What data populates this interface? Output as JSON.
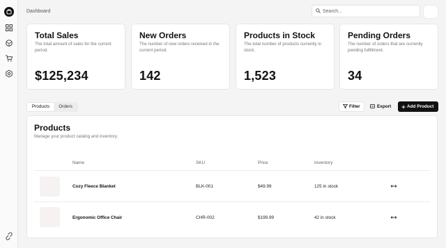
{
  "header": {
    "breadcrumb": "Dashboard",
    "search_placeholder": "Search..."
  },
  "sidebar": {
    "items": [
      {
        "icon": "grid-icon"
      },
      {
        "icon": "package-icon"
      },
      {
        "icon": "cart-icon"
      },
      {
        "icon": "settings-icon"
      }
    ],
    "bottom_icon": "link-icon"
  },
  "stats": [
    {
      "title": "Total Sales",
      "description": "The total amount of sales for the current period.",
      "value": "$125,234"
    },
    {
      "title": "New Orders",
      "description": "The number of new orders received in the current period.",
      "value": "142"
    },
    {
      "title": "Products in Stock",
      "description": "The total number of products currently in stock.",
      "value": "1,523"
    },
    {
      "title": "Pending Orders",
      "description": "The number of orders that are currently pending fulfillment.",
      "value": "34"
    }
  ],
  "tabs": [
    {
      "label": "Products",
      "active": true
    },
    {
      "label": "Orders",
      "active": false
    }
  ],
  "toolbar": {
    "filter_label": "Filter",
    "export_label": "Export",
    "add_label": "Add Product"
  },
  "products": {
    "title": "Products",
    "subtitle": "Manage your product catalog and inventory.",
    "columns": [
      "Name",
      "SKU",
      "Price",
      "Inventory"
    ],
    "rows": [
      {
        "name": "Cozy Fleece Blanket",
        "sku": "BLK-001",
        "price": "$49.99",
        "inventory": "125 in stock"
      },
      {
        "name": "Ergonomic Office Chair",
        "sku": "CHR-002",
        "price": "$199.99",
        "inventory": "42 in stock"
      }
    ]
  }
}
